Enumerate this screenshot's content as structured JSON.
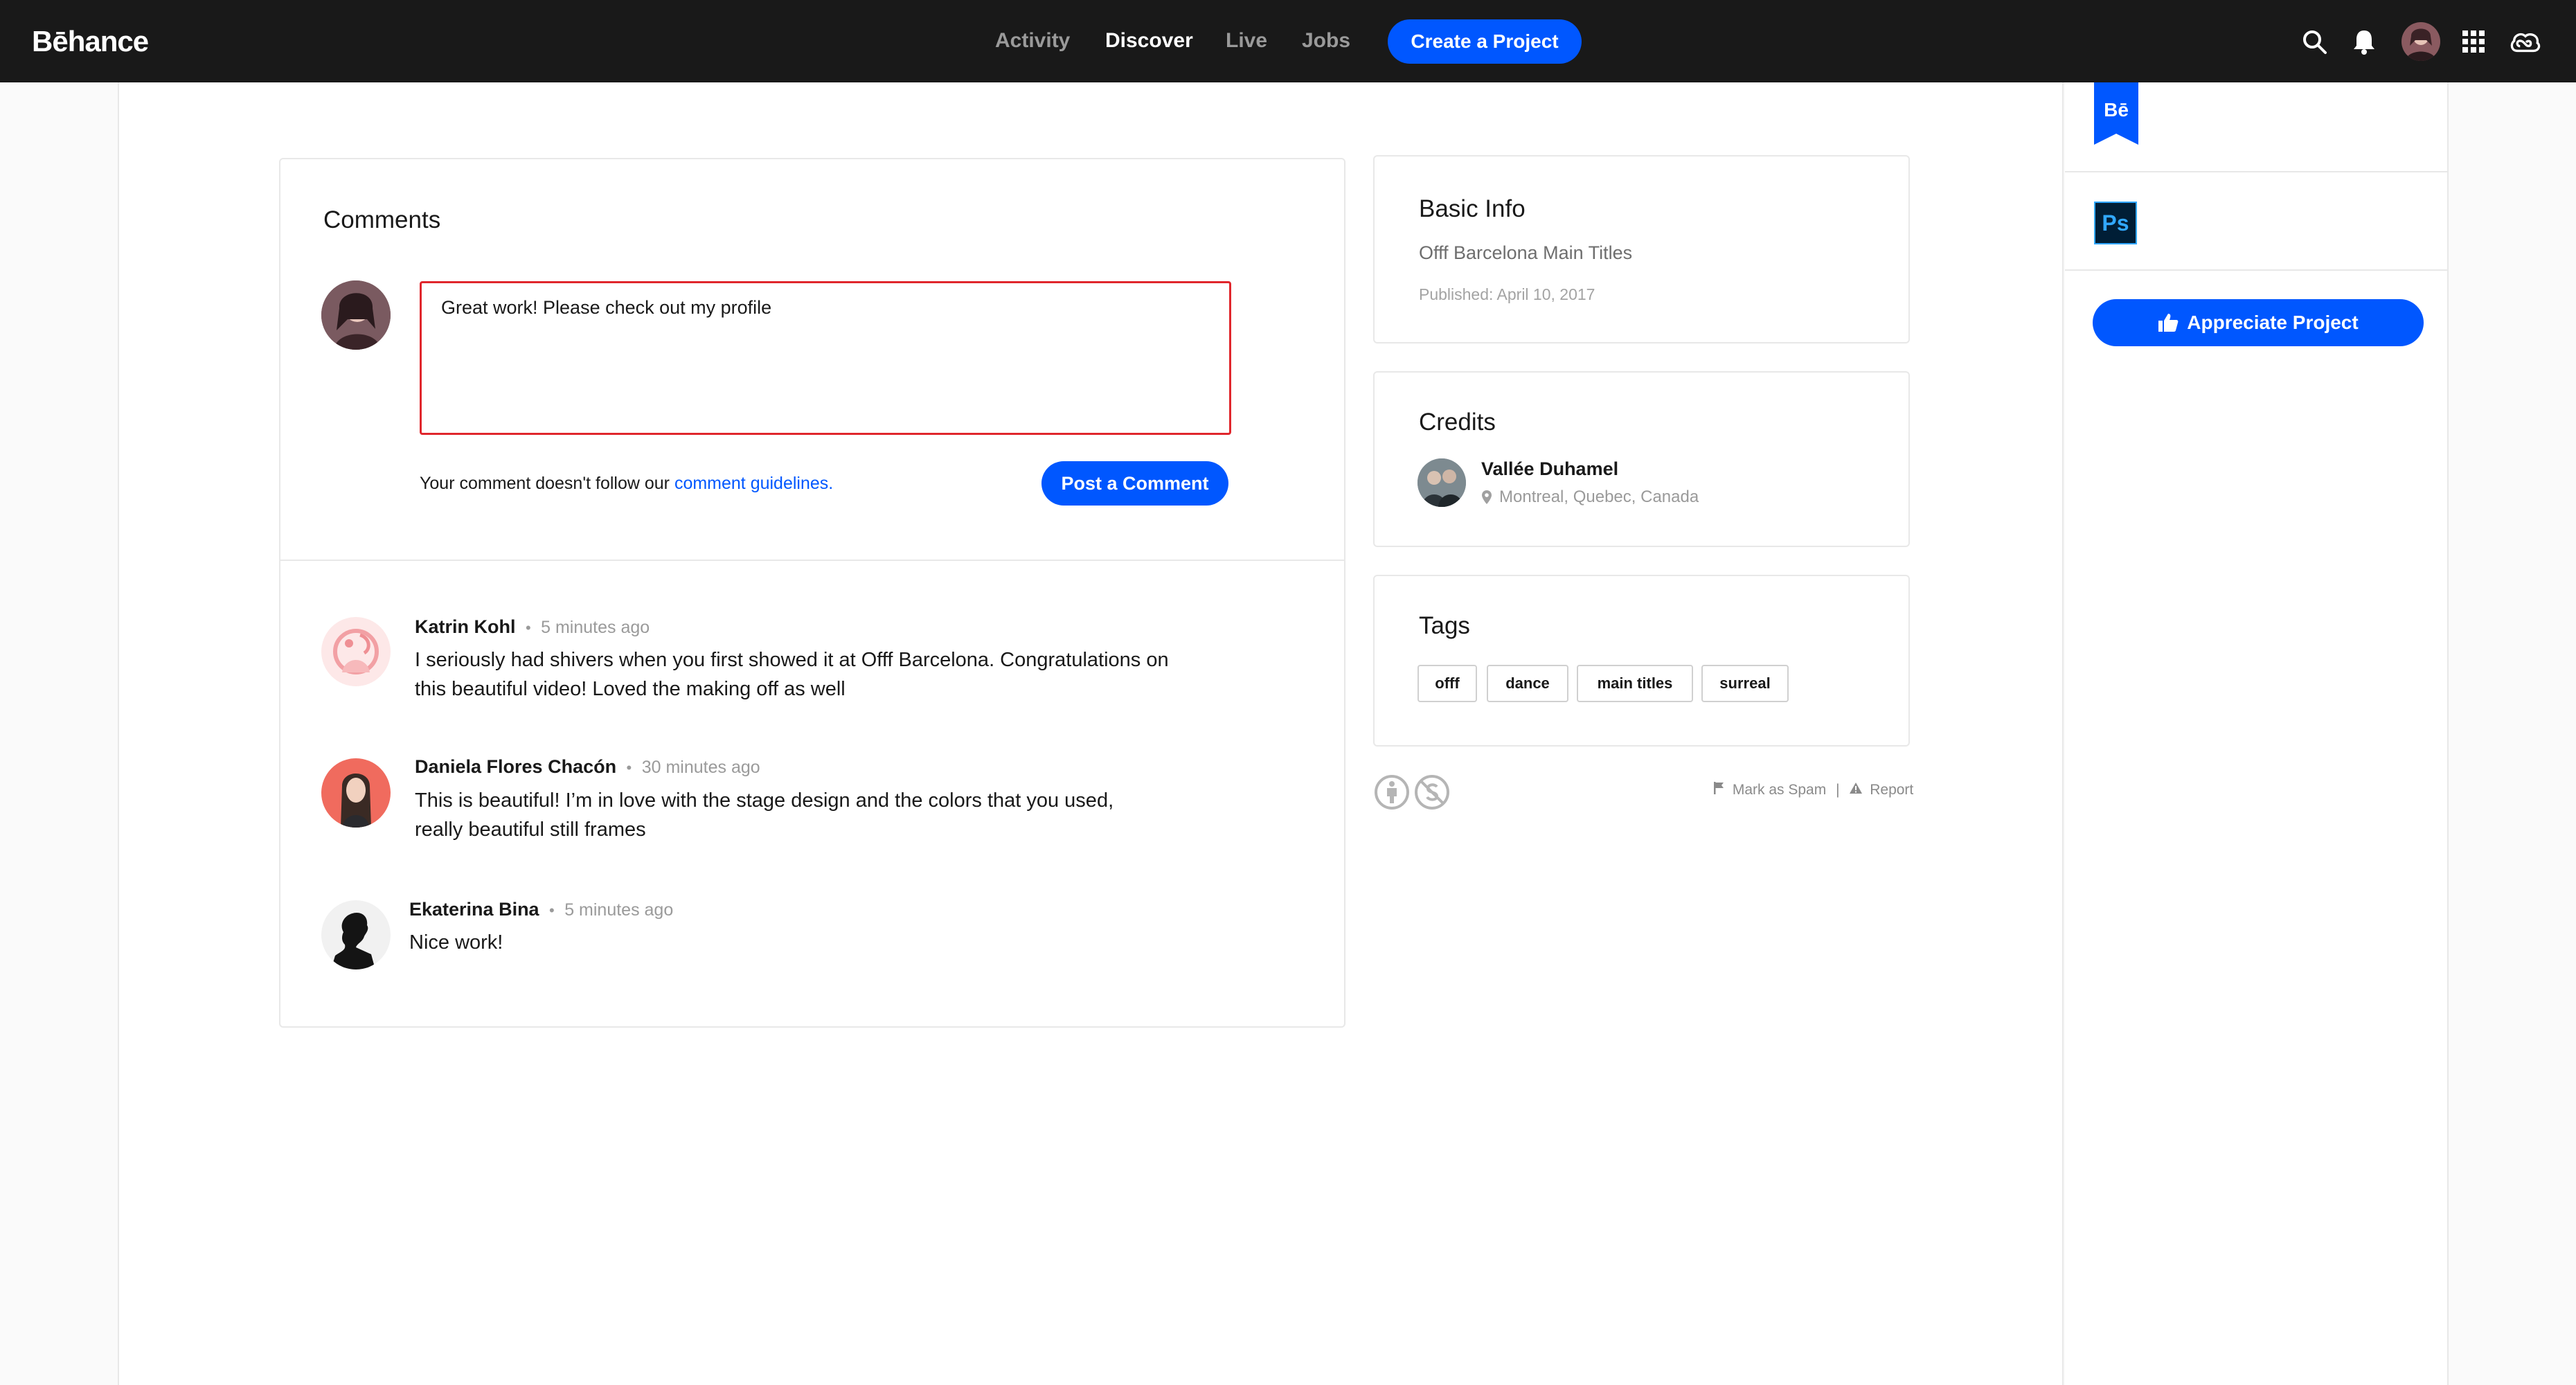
{
  "nav": {
    "logo": "Bēhance",
    "links": [
      "Activity",
      "Discover",
      "Live",
      "Jobs"
    ],
    "create_label": "Create a Project"
  },
  "comments": {
    "title": "Comments",
    "input_value": "Great work! Please check out my profile",
    "error_prefix": "Your comment doesn't follow our ",
    "error_link": "comment guidelines.",
    "post_label": "Post a Comment",
    "items": [
      {
        "name": "Katrin Kohl",
        "time": "5 minutes ago",
        "text": "I seriously had shivers when you first showed it at Offf Barcelona. Congratulations on this beautiful video! Loved the making off as well"
      },
      {
        "name": "Daniela Flores Chacón",
        "time": "30 minutes ago",
        "text": "This is beautiful! I’m in love with the stage design and the colors that you used, really beautiful still frames"
      },
      {
        "name": "Ekaterina Bina",
        "time": "5 minutes ago",
        "text": "Nice work!"
      }
    ]
  },
  "basic_info": {
    "title": "Basic Info",
    "project": "Offf Barcelona Main Titles",
    "published": "Published: April 10, 2017"
  },
  "credits": {
    "title": "Credits",
    "name": "Vallée Duhamel",
    "location": "Montreal, Quebec, Canada"
  },
  "tags": {
    "title": "Tags",
    "items": [
      "offf",
      "dance",
      "main titles",
      "surreal"
    ]
  },
  "footer": {
    "spam": "Mark as Spam",
    "separator": "|",
    "report": "Report"
  },
  "rail": {
    "badge": "Bē",
    "tool": "Ps",
    "appreciate_label": "Appreciate Project"
  },
  "colors": {
    "accent": "#0057ff",
    "nav_bg": "#191919",
    "error": "#e0262c",
    "ps_bg": "#001e36",
    "ps_fg": "#31a8ff"
  }
}
